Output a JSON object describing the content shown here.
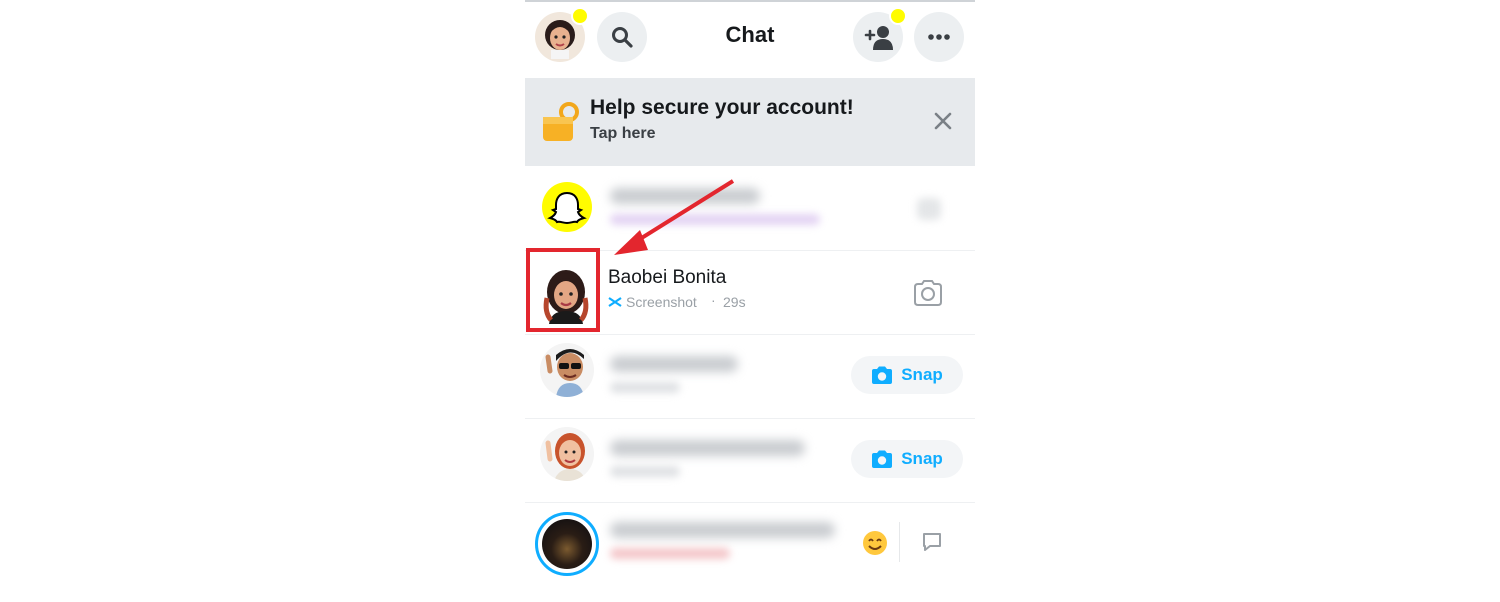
{
  "header": {
    "title": "Chat"
  },
  "banner": {
    "title": "Help secure your account!",
    "subtitle": "Tap here"
  },
  "chats": [
    {
      "name": "",
      "status": "",
      "blurred": true,
      "avatar": "snapchat-ghost-icon"
    },
    {
      "name": "Baobei Bonita",
      "status": "Screenshot",
      "time": "29s",
      "blurred": false,
      "action": "camera-icon"
    },
    {
      "name": "",
      "status": "",
      "blurred": true,
      "action_label": "Snap"
    },
    {
      "name": "",
      "status": "",
      "blurred": true,
      "action_label": "Snap"
    },
    {
      "name": "",
      "status": "",
      "blurred": true,
      "action": "chat-bubble-icon"
    }
  ],
  "snap_label_1": "Snap",
  "snap_label_2": "Snap",
  "colors": {
    "accent_blue": "#0fadff",
    "snap_yellow": "#fffc00",
    "highlight_red": "#e3262e",
    "banner_bg": "#e7eaed"
  }
}
